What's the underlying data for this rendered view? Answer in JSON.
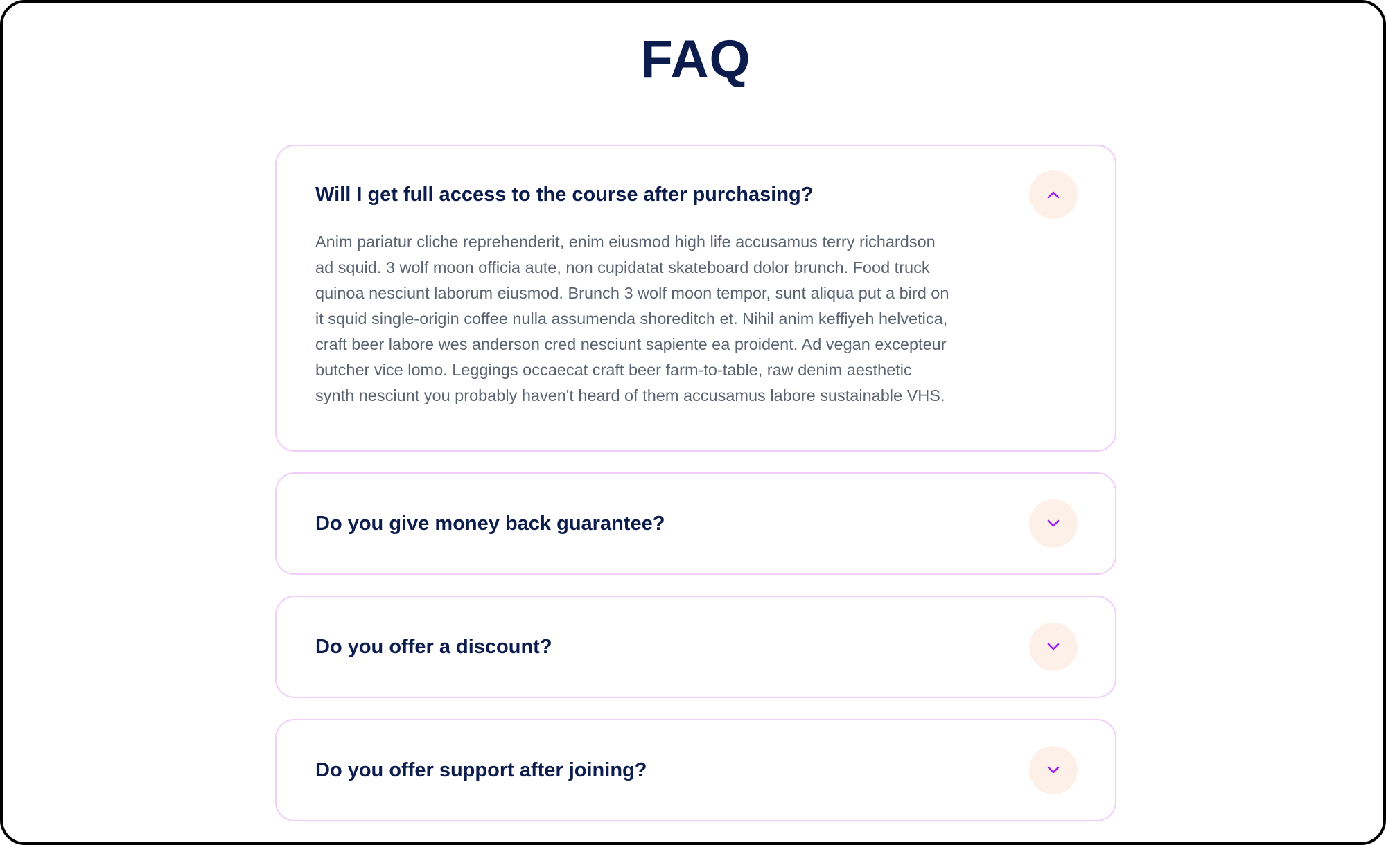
{
  "page": {
    "title": "FAQ"
  },
  "colors": {
    "title": "#0b1c4d",
    "question": "#0b1c4d",
    "answer": "#5b6270",
    "card_border": "#f0cdfa",
    "toggle_bg": "#fdf0e8",
    "chevron": "#9b1ff2"
  },
  "faq": {
    "items": [
      {
        "question": "Will I get full access to the course after purchasing?",
        "answer": "Anim pariatur cliche reprehenderit, enim eiusmod high life accusamus terry richardson ad squid. 3 wolf moon officia aute, non cupidatat skateboard dolor brunch. Food truck quinoa nesciunt laborum eiusmod. Brunch 3 wolf moon tempor, sunt aliqua put a bird on it squid single-origin coffee nulla assumenda shoreditch et. Nihil anim keffiyeh helvetica, craft beer labore wes anderson cred nesciunt sapiente ea proident. Ad vegan excepteur butcher vice lomo. Leggings occaecat craft beer farm-to-table, raw denim aesthetic synth nesciunt you probably haven't heard of them accusamus labore sustainable VHS.",
        "expanded": true,
        "toggle_icon": "chevron-up-icon"
      },
      {
        "question": "Do you give money back guarantee?",
        "expanded": false,
        "toggle_icon": "chevron-down-icon"
      },
      {
        "question": "Do you offer a discount?",
        "expanded": false,
        "toggle_icon": "chevron-down-icon"
      },
      {
        "question": "Do you offer support after joining?",
        "expanded": false,
        "toggle_icon": "chevron-down-icon"
      }
    ]
  }
}
